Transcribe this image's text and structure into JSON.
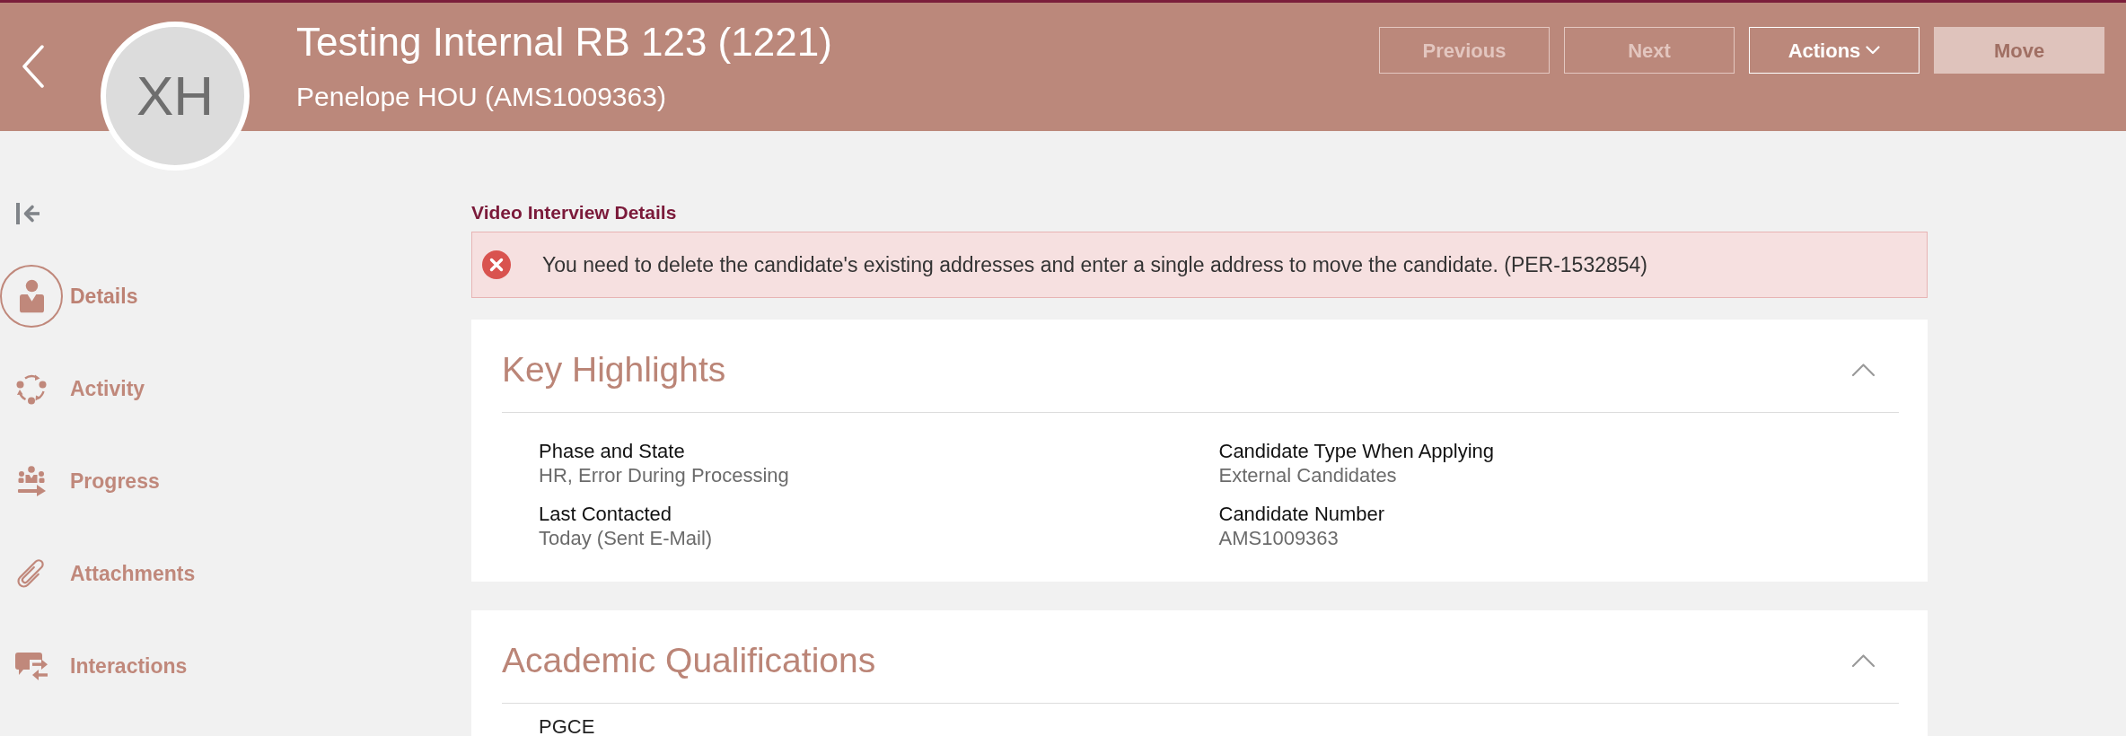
{
  "header": {
    "title": "Testing Internal RB 123 (1221)",
    "subtitle": "Penelope HOU (AMS1009363)",
    "avatar": {
      "initials": "XH"
    },
    "buttons": [
      {
        "label": "Previous",
        "kind": "outline",
        "disabled": true
      },
      {
        "label": "Next",
        "kind": "outline",
        "disabled": true
      },
      {
        "label": "Actions",
        "kind": "menu",
        "disabled": false
      },
      {
        "label": "Move",
        "kind": "solid",
        "disabled": true
      }
    ]
  },
  "sidebar": {
    "items": [
      {
        "label": "Details",
        "selected": true
      },
      {
        "label": "Activity",
        "selected": false
      },
      {
        "label": "Progress",
        "selected": false
      },
      {
        "label": "Attachments",
        "selected": false
      },
      {
        "label": "Interactions",
        "selected": false
      }
    ]
  },
  "section_link": "Video Interview Details",
  "alert": {
    "kind": "error",
    "message": "You need to delete the candidate's existing addresses and enter a single address to move the candidate. (PER-1532854)"
  },
  "sections": [
    {
      "title": "Key Highlights",
      "expanded": true,
      "fields": [
        {
          "label": "Phase and State",
          "value": "HR, Error During Processing"
        },
        {
          "label": "Candidate Type When Applying",
          "value": "External Candidates"
        },
        {
          "label": "Last Contacted",
          "value": "Today (Sent E-Mail)"
        },
        {
          "label": "Candidate Number",
          "value": "AMS1009363"
        }
      ]
    },
    {
      "title": "Academic Qualifications",
      "expanded": true,
      "entries": [
        {
          "title": "PGCE"
        }
      ]
    }
  ]
}
